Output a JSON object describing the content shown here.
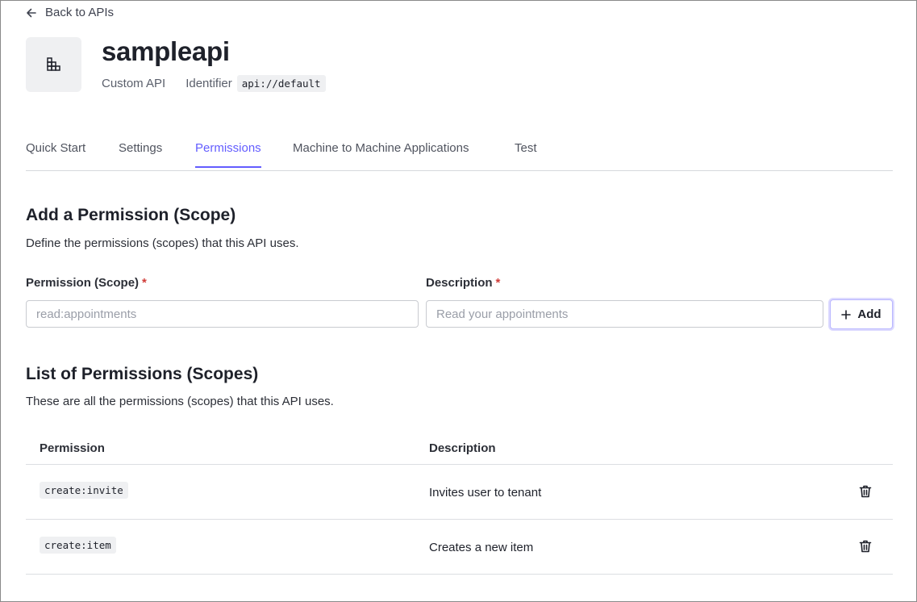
{
  "back_link": {
    "label": "Back to APIs"
  },
  "api": {
    "name": "sampleapi",
    "type": "Custom API",
    "identifier_label": "Identifier",
    "identifier": "api://default"
  },
  "tabs": [
    {
      "label": "Quick Start",
      "active": false
    },
    {
      "label": "Settings",
      "active": false
    },
    {
      "label": "Permissions",
      "active": true
    },
    {
      "label": "Machine to Machine Applications",
      "active": false
    },
    {
      "label": "Test",
      "active": false
    }
  ],
  "add_section": {
    "title": "Add a Permission (Scope)",
    "description": "Define the permissions (scopes) that this API uses.",
    "scope_label": "Permission (Scope)",
    "scope_placeholder": "read:appointments",
    "description_label": "Description",
    "description_placeholder": "Read your appointments",
    "required_marker": "*",
    "add_button": "Add"
  },
  "list_section": {
    "title": "List of Permissions (Scopes)",
    "description": "These are all the permissions (scopes) that this API uses.",
    "columns": [
      "Permission",
      "Description"
    ],
    "rows": [
      {
        "permission": "create:invite",
        "description": "Invites user to tenant"
      },
      {
        "permission": "create:item",
        "description": "Creates a new item"
      }
    ]
  },
  "colors": {
    "accent": "#635dff",
    "required": "#d03c38",
    "text": "#1e212a"
  },
  "icons": [
    "arrow-left-icon",
    "api-grid-icon",
    "plus-icon",
    "trash-icon"
  ]
}
